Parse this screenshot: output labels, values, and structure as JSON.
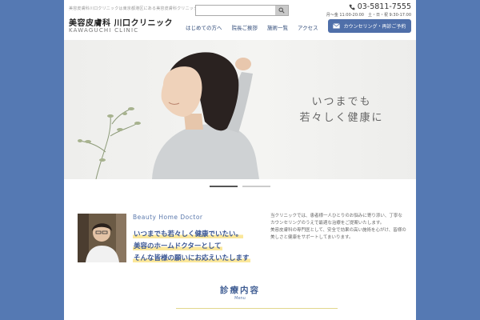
{
  "header": {
    "tagline": "美容皮膚科川口クリニックは東京都港区にある美容皮膚科クリニックです",
    "logo_jp": "美容皮膚科 川口クリニック",
    "logo_en": "KAWAGUCHI CLINIC",
    "search": {
      "value": "",
      "placeholder": ""
    },
    "phone": "03-5811-7555",
    "hours": "月〜金 11:00-20:00　土・日・祝 9:30-17:00",
    "reserve_label": "カウンセリング・再診ご予約"
  },
  "nav": {
    "items": [
      {
        "label": "はじめての方へ"
      },
      {
        "label": "院長ご挨拶"
      },
      {
        "label": "施術一覧"
      },
      {
        "label": "アクセス"
      }
    ]
  },
  "hero": {
    "line1": "いつまでも",
    "line2": "若々しく健康に"
  },
  "slider": {
    "active_index": 0,
    "count": 2
  },
  "intro": {
    "label": "Beauty Home Doctor",
    "line1": "いつまでも若々しく健康でいたい。",
    "line2": "美容のホームドクターとして",
    "line3": "そんな皆様の願いにお応えいたします",
    "paragraph1": "当クリニックでは、患者様一人ひとりのお悩みに寄り添い、丁寧なカウンセリングのうえで最適な治療をご提案いたします。",
    "paragraph2": "美容皮膚科の専門医として、安全で効果の高い施術を心がけ、皆様の美しさと健康をサポートしてまいります。"
  },
  "menu": {
    "title": "診療内容",
    "subtitle": "Menu"
  },
  "colors": {
    "background": "#5579b3",
    "accent": "#4f6fa9",
    "highlight": "#fbe79a",
    "heading": "#3a5694"
  }
}
